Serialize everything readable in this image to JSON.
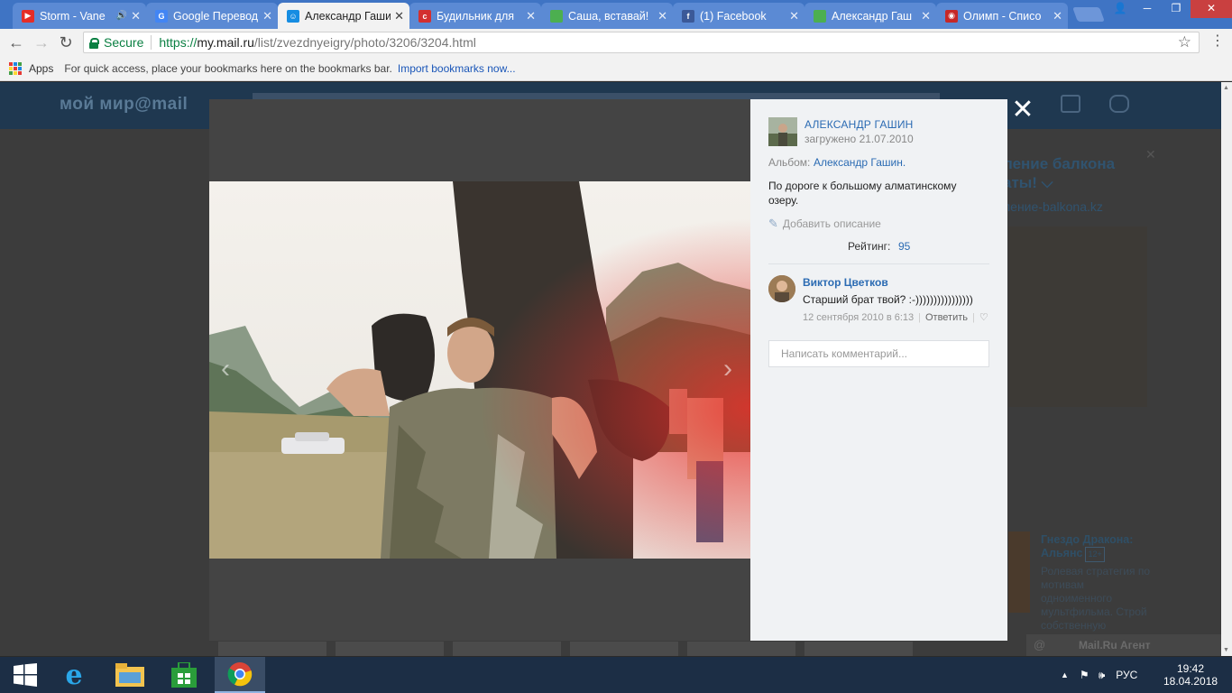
{
  "browser": {
    "tabs": [
      {
        "title": "Storm - Vane",
        "favicon_color": "#e52d27",
        "active": false,
        "audio": true
      },
      {
        "title": "Google Перевод",
        "favicon_color": "#4285f4",
        "active": false
      },
      {
        "title": "Александр Гашин",
        "favicon_color": "#168de2",
        "active": true
      },
      {
        "title": "Будильник для",
        "favicon_color": "#d32f2f",
        "active": false
      },
      {
        "title": "Саша, вставай!",
        "favicon_color": "#4caf50",
        "active": false
      },
      {
        "title": "(1) Facebook",
        "favicon_color": "#3b5998",
        "active": false
      },
      {
        "title": "Александр Гаш",
        "favicon_color": "#4caf50",
        "active": false
      },
      {
        "title": "Олимп - Списо",
        "favicon_color": "#c62828",
        "active": false
      }
    ],
    "security_label": "Secure",
    "url_protocol": "https://",
    "url_host": "my.mail.ru",
    "url_path": "/list/zvezdnyeigry/photo/3206/3204.html",
    "bookmarks": {
      "apps_label": "Apps",
      "hint": "For quick access, place your bookmarks here on the bookmarks bar.",
      "import_link": "Import bookmarks now..."
    }
  },
  "background_page": {
    "logo": "мой мир@mail",
    "ad_title": "ление балкона\nаты! ⌵",
    "ad_url": "ление-balkona.kz",
    "game_title": "Гнездо Дракона: Альянс",
    "game_badge": "12+",
    "game_desc": "Ролевая стратегия по мотивам одноименного мультфильма. Строй собственную",
    "agent_label": "Mail.Ru Агент"
  },
  "photo_viewer": {
    "author": "АЛЕКСАНДР ГАШИН",
    "uploaded": "загружено 21.07.2010",
    "album_label": "Альбом:",
    "album_name": "Александр Гашин.",
    "caption": "По дороге к большому алматинскому озеру.",
    "add_description": "Добавить описание",
    "rating_label": "Рейтинг:",
    "rating_value": "95",
    "comments": [
      {
        "author": "Виктор Цветков",
        "text": "Старший брат твой? :-))))))))))))))))",
        "date": "12 сентября 2010 в 6:13",
        "reply_label": "Ответить"
      }
    ],
    "comment_placeholder": "Написать комментарий..."
  },
  "taskbar": {
    "language": "РУС",
    "time": "19:42",
    "date": "18.04.2018"
  }
}
